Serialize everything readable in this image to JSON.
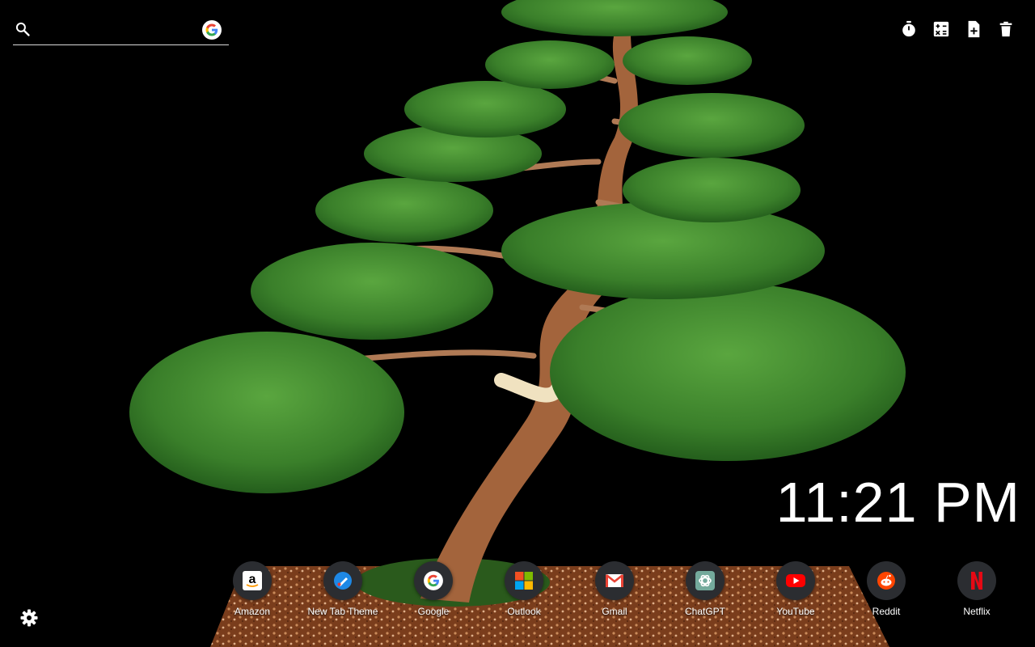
{
  "search": {
    "placeholder": "",
    "engine_icon": "google-g-icon"
  },
  "toolbar": {
    "items": [
      {
        "icon": "stopwatch-icon"
      },
      {
        "icon": "calculator-icon"
      },
      {
        "icon": "add-note-icon"
      },
      {
        "icon": "trash-icon"
      }
    ]
  },
  "clock": {
    "time": "11:21 PM"
  },
  "shortcuts": [
    {
      "label": "Amazon",
      "icon": "amazon-icon"
    },
    {
      "label": "New Tab Theme",
      "icon": "new-tab-theme-icon"
    },
    {
      "label": "Google",
      "icon": "google-icon"
    },
    {
      "label": "Outlook",
      "icon": "microsoft-icon"
    },
    {
      "label": "Gmail",
      "icon": "gmail-icon"
    },
    {
      "label": "ChatGPT",
      "icon": "chatgpt-icon"
    },
    {
      "label": "YouTube",
      "icon": "youtube-icon"
    },
    {
      "label": "Reddit",
      "icon": "reddit-icon"
    },
    {
      "label": "Netflix",
      "icon": "netflix-icon"
    }
  ],
  "settings": {
    "icon": "gear-icon"
  },
  "colors": {
    "background": "#000000",
    "foliage": "#3f8a2e",
    "trunk": "#a0623c",
    "gravel": "#8a4a22"
  }
}
